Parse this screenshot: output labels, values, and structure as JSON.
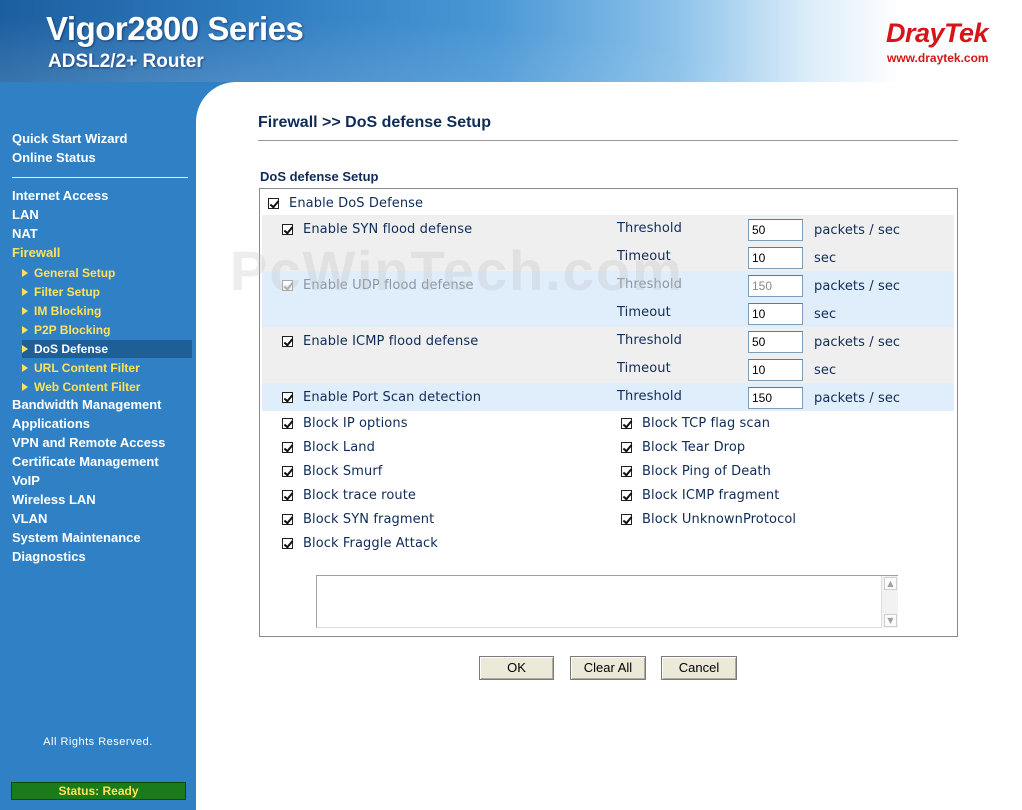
{
  "header": {
    "product_title": "Vigor2800 Series",
    "product_subtitle": "ADSL2/2+ Router",
    "brand": "DrayTek",
    "brand_url": "www.draytek.com"
  },
  "sidebar": {
    "top_items": [
      "Quick Start Wizard",
      "Online Status"
    ],
    "items": [
      "Internet Access",
      "LAN",
      "NAT",
      "Firewall"
    ],
    "firewall_sub": [
      "General Setup",
      "Filter Setup",
      "IM Blocking",
      "P2P Blocking",
      "DoS Defense",
      "URL Content Filter",
      "Web Content Filter"
    ],
    "more_items": [
      "Bandwidth Management",
      "Applications",
      "VPN and Remote Access",
      "Certificate Management",
      "VoIP",
      "Wireless LAN",
      "VLAN",
      "System Maintenance",
      "Diagnostics"
    ],
    "rights": "All Rights Reserved.",
    "status": "Status: Ready"
  },
  "page": {
    "title": "Firewall >> DoS defense Setup",
    "section_title": "DoS defense Setup",
    "watermark": "PcWinTech.com"
  },
  "form": {
    "enable_dos": "Enable DoS Defense",
    "syn_label": "Enable SYN flood defense",
    "udp_label": "Enable UDP flood defense",
    "icmp_label": "Enable ICMP flood defense",
    "portscan_label": "Enable Port Scan detection",
    "threshold_label": "Threshold",
    "timeout_label": "Timeout",
    "pps_unit": "packets / sec",
    "sec_unit": "sec",
    "syn_threshold": "50",
    "syn_timeout": "10",
    "udp_threshold": "150",
    "udp_timeout": "10",
    "icmp_threshold": "50",
    "icmp_timeout": "10",
    "portscan_threshold": "150",
    "blocks_left": [
      "Block IP options",
      "Block Land",
      "Block Smurf",
      "Block trace route",
      "Block SYN fragment",
      "Block Fraggle Attack"
    ],
    "blocks_right": [
      "Block TCP flag scan",
      "Block Tear Drop",
      "Block Ping of Death",
      "Block ICMP fragment",
      "Block UnknownProtocol"
    ],
    "notes_text": ""
  },
  "buttons": {
    "ok": "OK",
    "clear_all": "Clear All",
    "cancel": "Cancel"
  }
}
